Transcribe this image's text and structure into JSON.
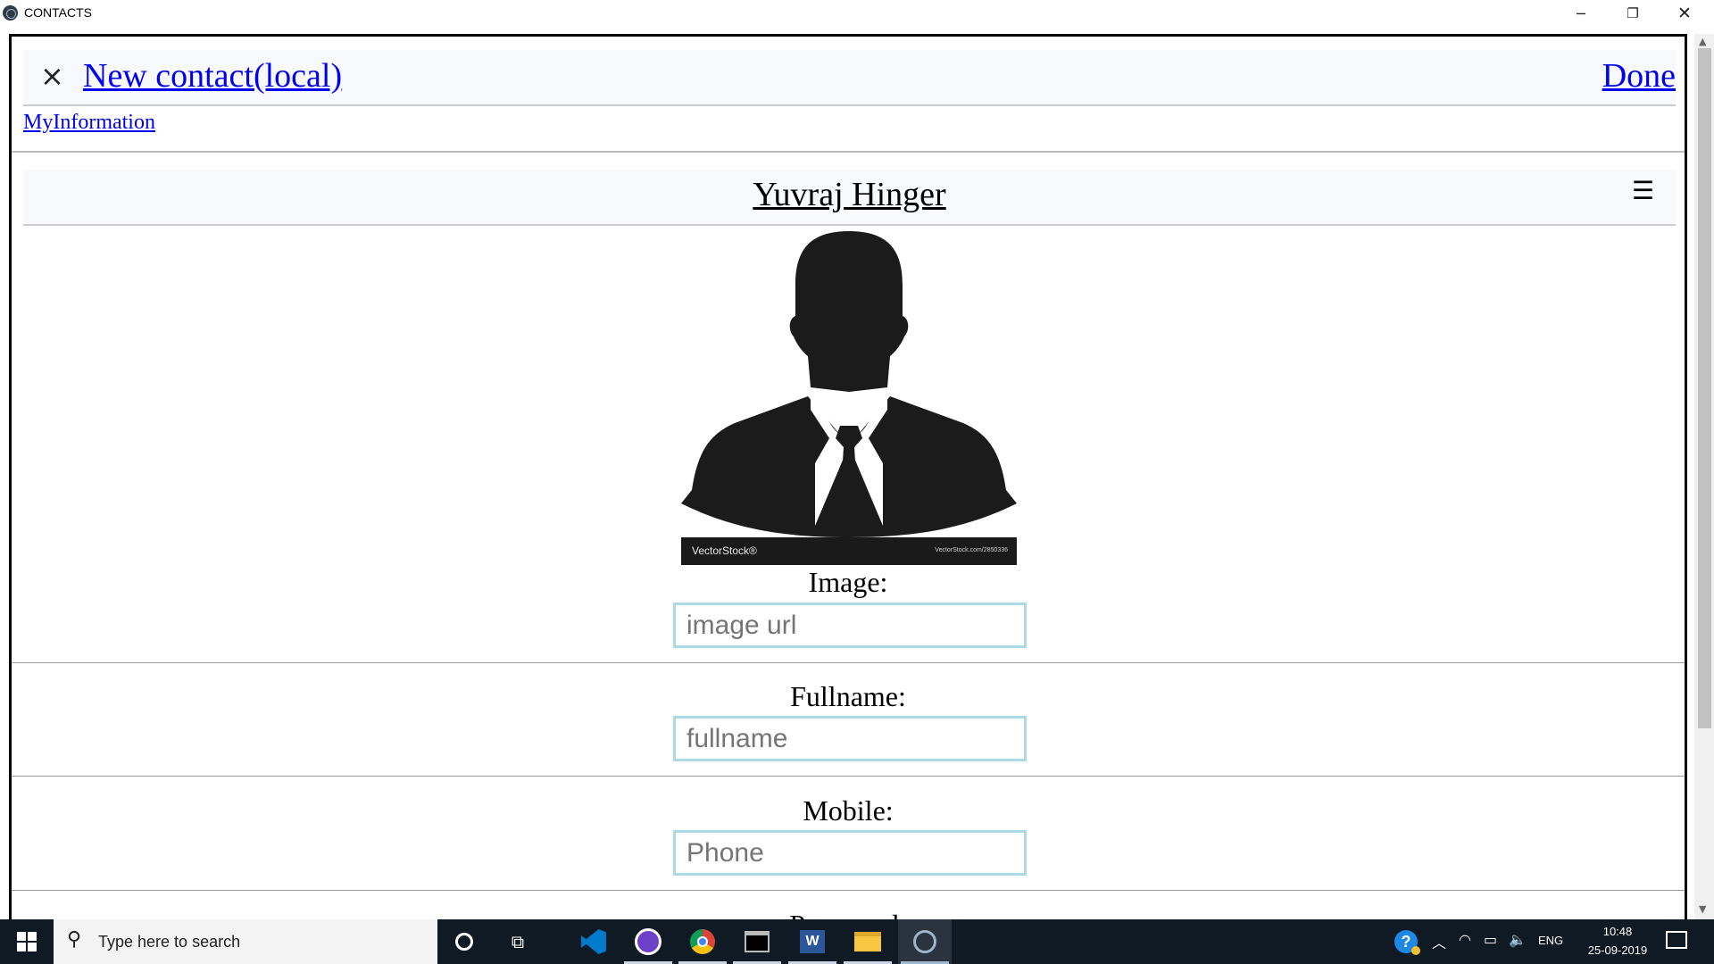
{
  "window": {
    "title": "CONTACTS",
    "controls": {
      "minimize": "─",
      "restore": "❐",
      "close": "✕"
    }
  },
  "header": {
    "close_glyph": "×",
    "title_link": "New contact(local)",
    "done_link": "Done"
  },
  "nav": {
    "my_information_link": "MyInformation"
  },
  "contact": {
    "name": "Yuvraj Hinger",
    "menu_glyph": "☰",
    "avatar": {
      "brand": "VectorStock®",
      "url": "VectorStock.com/2850336"
    }
  },
  "form": {
    "image": {
      "label": "Image:",
      "placeholder": "image url",
      "value": ""
    },
    "fullname": {
      "label": "Fullname:",
      "placeholder": "fullname",
      "value": ""
    },
    "mobile": {
      "label": "Mobile:",
      "placeholder": "Phone",
      "value": ""
    },
    "password": {
      "label": "Password:"
    }
  },
  "taskbar": {
    "search_placeholder": "Type here to search",
    "pinned": [
      "cortana-icon",
      "task-view-icon",
      "vscode-icon",
      "github-desktop-icon",
      "chrome-icon",
      "terminal-icon",
      "word-icon",
      "file-explorer-icon",
      "contacts-app-icon"
    ],
    "tray": {
      "language": "ENG",
      "time": "10:48",
      "date": "25-09-2019"
    }
  },
  "colors": {
    "link": "#0000ee",
    "input_border": "#add8e6",
    "header_bg": "#f8f9fc",
    "taskbar_bg": "#101a24"
  }
}
